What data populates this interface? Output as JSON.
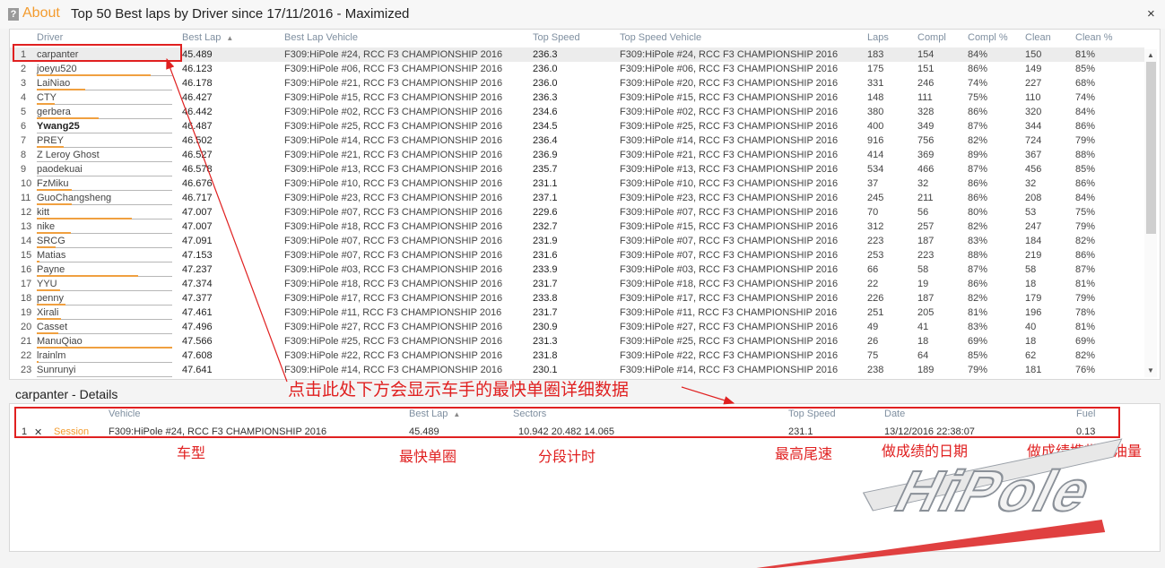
{
  "window": {
    "help_icon": "?",
    "about_label": "About",
    "title": "Top 50 Best laps by Driver since 17/11/2016 - Maximized",
    "close_icon": "×"
  },
  "table": {
    "columns": [
      "Driver",
      "Best Lap",
      "Best Lap Vehicle",
      "Top Speed",
      "Top Speed Vehicle",
      "Laps",
      "Compl",
      "Compl %",
      "Clean",
      "Clean %"
    ],
    "sort_icon": "▲",
    "rows": [
      {
        "n": "1",
        "driver": "carpanter",
        "best": "45.489",
        "blv": "F309:HiPole #24, RCC F3 CHAMPIONSHIP 2016",
        "ts": "236.3",
        "tsv": "F309:HiPole #24, RCC F3 CHAMPIONSHIP 2016",
        "laps": "183",
        "compl": "154",
        "complp": "84%",
        "clean": "150",
        "cleanp": "81%"
      },
      {
        "n": "2",
        "driver": "joeyu520",
        "best": "46.123",
        "blv": "F309:HiPole #06, RCC F3 CHAMPIONSHIP 2016",
        "ts": "236.0",
        "tsv": "F309:HiPole #06, RCC F3 CHAMPIONSHIP 2016",
        "laps": "175",
        "compl": "151",
        "complp": "86%",
        "clean": "149",
        "cleanp": "85%"
      },
      {
        "n": "3",
        "driver": "LaiNiao",
        "best": "46.178",
        "blv": "F309:HiPole #21, RCC F3 CHAMPIONSHIP 2016",
        "ts": "236.0",
        "tsv": "F309:HiPole #20, RCC F3 CHAMPIONSHIP 2016",
        "laps": "331",
        "compl": "246",
        "complp": "74%",
        "clean": "227",
        "cleanp": "68%"
      },
      {
        "n": "4",
        "driver": "CTY",
        "best": "46.427",
        "blv": "F309:HiPole #15, RCC F3 CHAMPIONSHIP 2016",
        "ts": "236.3",
        "tsv": "F309:HiPole #15, RCC F3 CHAMPIONSHIP 2016",
        "laps": "148",
        "compl": "111",
        "complp": "75%",
        "clean": "110",
        "cleanp": "74%"
      },
      {
        "n": "5",
        "driver": "gerbera",
        "best": "46.442",
        "blv": "F309:HiPole #02, RCC F3 CHAMPIONSHIP 2016",
        "ts": "234.6",
        "tsv": "F309:HiPole #02, RCC F3 CHAMPIONSHIP 2016",
        "laps": "380",
        "compl": "328",
        "complp": "86%",
        "clean": "320",
        "cleanp": "84%"
      },
      {
        "n": "6",
        "driver": "Ywang25",
        "best": "46.487",
        "blv": "F309:HiPole #25, RCC F3 CHAMPIONSHIP 2016",
        "ts": "234.5",
        "tsv": "F309:HiPole #25, RCC F3 CHAMPIONSHIP 2016",
        "laps": "400",
        "compl": "349",
        "complp": "87%",
        "clean": "344",
        "cleanp": "86%"
      },
      {
        "n": "7",
        "driver": "PREY",
        "best": "46.502",
        "blv": "F309:HiPole #14, RCC F3 CHAMPIONSHIP 2016",
        "ts": "236.4",
        "tsv": "F309:HiPole #14, RCC F3 CHAMPIONSHIP 2016",
        "laps": "916",
        "compl": "756",
        "complp": "82%",
        "clean": "724",
        "cleanp": "79%"
      },
      {
        "n": "8",
        "driver": "Z Leroy Ghost",
        "best": "46.527",
        "blv": "F309:HiPole #21, RCC F3 CHAMPIONSHIP 2016",
        "ts": "236.9",
        "tsv": "F309:HiPole #21, RCC F3 CHAMPIONSHIP 2016",
        "laps": "414",
        "compl": "369",
        "complp": "89%",
        "clean": "367",
        "cleanp": "88%"
      },
      {
        "n": "9",
        "driver": "paodekuai",
        "best": "46.578",
        "blv": "F309:HiPole #13, RCC F3 CHAMPIONSHIP 2016",
        "ts": "235.7",
        "tsv": "F309:HiPole #13, RCC F3 CHAMPIONSHIP 2016",
        "laps": "534",
        "compl": "466",
        "complp": "87%",
        "clean": "456",
        "cleanp": "85%"
      },
      {
        "n": "10",
        "driver": "FzMiku",
        "best": "46.676",
        "blv": "F309:HiPole #10, RCC F3 CHAMPIONSHIP 2016",
        "ts": "231.1",
        "tsv": "F309:HiPole #10, RCC F3 CHAMPIONSHIP 2016",
        "laps": "37",
        "compl": "32",
        "complp": "86%",
        "clean": "32",
        "cleanp": "86%"
      },
      {
        "n": "11",
        "driver": "GuoChangsheng",
        "best": "46.717",
        "blv": "F309:HiPole #23, RCC F3 CHAMPIONSHIP 2016",
        "ts": "237.1",
        "tsv": "F309:HiPole #23, RCC F3 CHAMPIONSHIP 2016",
        "laps": "245",
        "compl": "211",
        "complp": "86%",
        "clean": "208",
        "cleanp": "84%"
      },
      {
        "n": "12",
        "driver": "kitt",
        "best": "47.007",
        "blv": "F309:HiPole #07, RCC F3 CHAMPIONSHIP 2016",
        "ts": "229.6",
        "tsv": "F309:HiPole #07, RCC F3 CHAMPIONSHIP 2016",
        "laps": "70",
        "compl": "56",
        "complp": "80%",
        "clean": "53",
        "cleanp": "75%"
      },
      {
        "n": "13",
        "driver": "nike",
        "best": "47.007",
        "blv": "F309:HiPole #18, RCC F3 CHAMPIONSHIP 2016",
        "ts": "232.7",
        "tsv": "F309:HiPole #15, RCC F3 CHAMPIONSHIP 2016",
        "laps": "312",
        "compl": "257",
        "complp": "82%",
        "clean": "247",
        "cleanp": "79%"
      },
      {
        "n": "14",
        "driver": "SRCG",
        "best": "47.091",
        "blv": "F309:HiPole #07, RCC F3 CHAMPIONSHIP 2016",
        "ts": "231.9",
        "tsv": "F309:HiPole #07, RCC F3 CHAMPIONSHIP 2016",
        "laps": "223",
        "compl": "187",
        "complp": "83%",
        "clean": "184",
        "cleanp": "82%"
      },
      {
        "n": "15",
        "driver": "Matias",
        "best": "47.153",
        "blv": "F309:HiPole #07, RCC F3 CHAMPIONSHIP 2016",
        "ts": "231.6",
        "tsv": "F309:HiPole #07, RCC F3 CHAMPIONSHIP 2016",
        "laps": "253",
        "compl": "223",
        "complp": "88%",
        "clean": "219",
        "cleanp": "86%"
      },
      {
        "n": "16",
        "driver": "Payne",
        "best": "47.237",
        "blv": "F309:HiPole #03, RCC F3 CHAMPIONSHIP 2016",
        "ts": "233.9",
        "tsv": "F309:HiPole #03, RCC F3 CHAMPIONSHIP 2016",
        "laps": "66",
        "compl": "58",
        "complp": "87%",
        "clean": "58",
        "cleanp": "87%"
      },
      {
        "n": "17",
        "driver": "YYU",
        "best": "47.374",
        "blv": "F309:HiPole #18, RCC F3 CHAMPIONSHIP 2016",
        "ts": "231.7",
        "tsv": "F309:HiPole #18, RCC F3 CHAMPIONSHIP 2016",
        "laps": "22",
        "compl": "19",
        "complp": "86%",
        "clean": "18",
        "cleanp": "81%"
      },
      {
        "n": "18",
        "driver": "penny",
        "best": "47.377",
        "blv": "F309:HiPole #17, RCC F3 CHAMPIONSHIP 2016",
        "ts": "233.8",
        "tsv": "F309:HiPole #17, RCC F3 CHAMPIONSHIP 2016",
        "laps": "226",
        "compl": "187",
        "complp": "82%",
        "clean": "179",
        "cleanp": "79%"
      },
      {
        "n": "19",
        "driver": "Xirali",
        "best": "47.461",
        "blv": "F309:HiPole #11, RCC F3 CHAMPIONSHIP 2016",
        "ts": "231.7",
        "tsv": "F309:HiPole #11, RCC F3 CHAMPIONSHIP 2016",
        "laps": "251",
        "compl": "205",
        "complp": "81%",
        "clean": "196",
        "cleanp": "78%"
      },
      {
        "n": "20",
        "driver": "Casset",
        "best": "47.496",
        "blv": "F309:HiPole #27, RCC F3 CHAMPIONSHIP 2016",
        "ts": "230.9",
        "tsv": "F309:HiPole #27, RCC F3 CHAMPIONSHIP 2016",
        "laps": "49",
        "compl": "41",
        "complp": "83%",
        "clean": "40",
        "cleanp": "81%"
      },
      {
        "n": "21",
        "driver": "ManuQiao",
        "best": "47.566",
        "blv": "F309:HiPole #25, RCC F3 CHAMPIONSHIP 2016",
        "ts": "231.3",
        "tsv": "F309:HiPole #25, RCC F3 CHAMPIONSHIP 2016",
        "laps": "26",
        "compl": "18",
        "complp": "69%",
        "clean": "18",
        "cleanp": "69%"
      },
      {
        "n": "22",
        "driver": "lrainlm",
        "best": "47.608",
        "blv": "F309:HiPole #22, RCC F3 CHAMPIONSHIP 2016",
        "ts": "231.8",
        "tsv": "F309:HiPole #22, RCC F3 CHAMPIONSHIP 2016",
        "laps": "75",
        "compl": "64",
        "complp": "85%",
        "clean": "62",
        "cleanp": "82%"
      },
      {
        "n": "23",
        "driver": "Sunrunyi",
        "best": "47.641",
        "blv": "F309:HiPole #14, RCC F3 CHAMPIONSHIP 2016",
        "ts": "230.1",
        "tsv": "F309:HiPole #14, RCC F3 CHAMPIONSHIP 2016",
        "laps": "238",
        "compl": "189",
        "complp": "79%",
        "clean": "181",
        "cleanp": "76%"
      }
    ],
    "driver_bar_fraction": [
      0,
      0.84,
      0.36,
      0.13,
      0.46,
      0,
      0.2,
      0,
      0,
      0.26,
      0.26,
      0.7,
      0.25,
      0.14,
      0.02,
      0.75,
      0.17,
      0.21,
      0.18,
      0.16,
      1.0,
      0.01,
      0
    ],
    "bold_row": 6
  },
  "details": {
    "title": "carpanter - Details",
    "columns": [
      "Vehicle",
      "Best Lap",
      "Sectors",
      "Top Speed",
      "Date",
      "Fuel"
    ],
    "row": {
      "n": "1",
      "x": "✕",
      "session": "Session",
      "vehicle": "F309:HiPole #24, RCC F3 CHAMPIONSHIP 2016",
      "best": "45.489",
      "sectors": "10.942  20.482  14.065",
      "ts": "231.1",
      "date": "13/12/2016 22:38:07",
      "fuel": "0.13"
    }
  },
  "annotations": {
    "main": "点击此处下方会显示车手的最快单圈详细数据",
    "vehicle": "车型",
    "best_lap": "最快单圈",
    "sectors": "分段计时",
    "top_speed": "最高尾速",
    "date": "做成绩的日期",
    "fuel": "做成绩携带的油量"
  },
  "colors": {
    "accent": "#f39b2e",
    "annotation": "#e02020",
    "bar": "#f0a040"
  }
}
